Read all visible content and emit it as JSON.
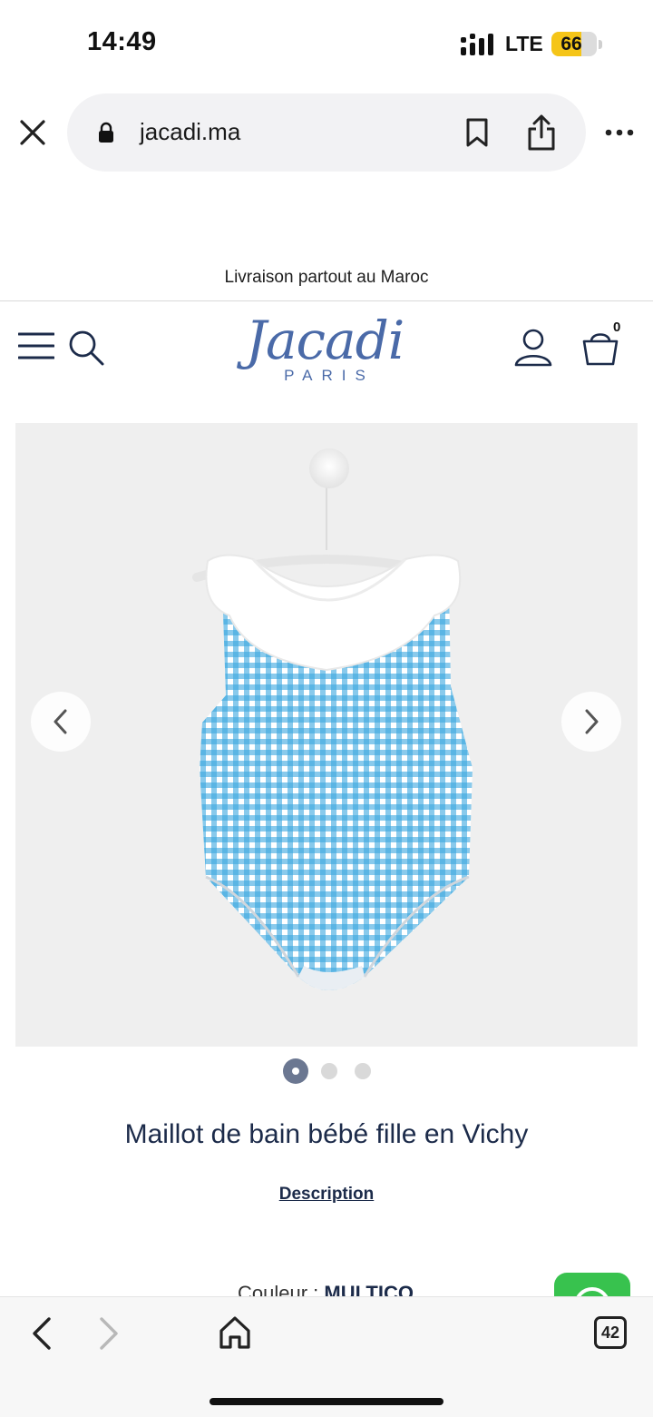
{
  "status_bar": {
    "time": "14:49",
    "network": "LTE",
    "battery": "66"
  },
  "browser": {
    "url": "jacadi.ma",
    "tab_count": "42"
  },
  "site": {
    "promo_banner": "Livraison partout au Maroc",
    "logo_main": "Jacadi",
    "logo_sub": "PARIS",
    "cart_count": "0"
  },
  "product": {
    "title": "Maillot de bain bébé fille en Vichy",
    "description_link": "Description",
    "color_label": "Couleur :",
    "color_value": "MULTICO",
    "gallery_total_images": 3,
    "gallery_current_index": 0
  },
  "colors": {
    "brand_blue": "#4a6aa8",
    "text_navy": "#1c2b4a",
    "gingham_blue": "#3aa6e0",
    "whatsapp_green": "#38c24e"
  }
}
